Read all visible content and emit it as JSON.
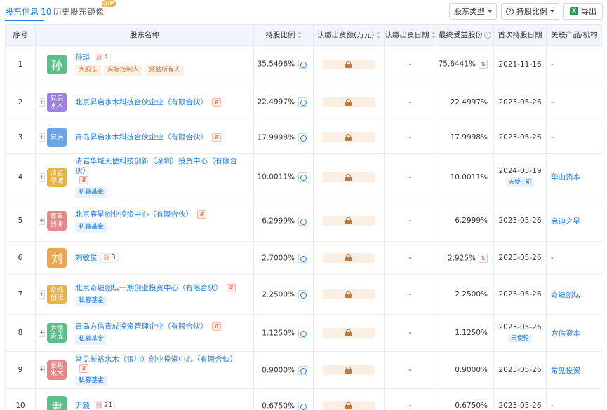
{
  "tabs": {
    "active_label": "股东信息",
    "active_count": "10",
    "history_label": "历史股东镜像",
    "vip_badge": "VIP"
  },
  "toolbar": {
    "type_label": "股东类型",
    "ratio_label": "持股比例",
    "export_label": "导出"
  },
  "columns": {
    "index": "序号",
    "name": "股东名称",
    "ratio": "持股比例",
    "subscribed": "认缴出资额(万元)",
    "sub_date": "认缴出资日期",
    "benefit": "最终受益股份",
    "first_date": "首次持股日期",
    "related": "关联产品/机构"
  },
  "colors": {
    "accent": "#1e7be6",
    "avatar_green": "#5cbf8a",
    "avatar_purple": "#9b7fe0",
    "avatar_blue": "#6aa6e6",
    "avatar_gold": "#e6b34a",
    "avatar_red": "#e38a86",
    "avatar_orange": "#e9a656"
  },
  "rows": [
    {
      "idx": "1",
      "avatar": "孙",
      "avatar_color": "#5cbf8a",
      "avatar_size": "big",
      "name": "孙琪",
      "person_count": "4",
      "tags": [
        "大股东",
        "实际控制人",
        "受益所有人"
      ],
      "fund_tag": "",
      "ratio": "35.5496%",
      "sub_date": "-",
      "benefit": "75.6441%",
      "benefit_icon": true,
      "first_date": "2021-11-16",
      "round": "",
      "related": "-"
    },
    {
      "idx": "2",
      "avatar": "昇启水木",
      "avatar_color": "#9b7fe0",
      "avatar_size": "small",
      "name": "北京昇启水木科技合伙企业（有限合伙）",
      "person_count": "",
      "tags": [],
      "fund_tag": "",
      "ratio": "22.4997%",
      "sub_date": "-",
      "benefit": "22.4997%",
      "benefit_icon": false,
      "first_date": "2023-05-26",
      "round": "",
      "related": "-"
    },
    {
      "idx": "3",
      "avatar": "昇启",
      "avatar_color": "#6aa6e6",
      "avatar_size": "small",
      "name": "青岛昇启水木科技合伙企业（有限合伙）",
      "person_count": "",
      "tags": [],
      "fund_tag": "",
      "ratio": "17.9998%",
      "sub_date": "-",
      "benefit": "17.9998%",
      "benefit_icon": false,
      "first_date": "2023-05-26",
      "round": "",
      "related": "-"
    },
    {
      "idx": "4",
      "avatar": "清岩华域",
      "avatar_color": "#e6b34a",
      "avatar_size": "small",
      "name": "清岩华域天使科技创新（深圳）投资中心（有限合伙）",
      "person_count": "",
      "tags": [],
      "fund_tag": "私募基金",
      "ratio": "10.0011%",
      "sub_date": "-",
      "benefit": "10.0011%",
      "benefit_icon": false,
      "first_date": "2024-03-19",
      "round": "天使+轮",
      "related": "华山资本"
    },
    {
      "idx": "5",
      "avatar": "宸星创业",
      "avatar_color": "#e38a86",
      "avatar_size": "small",
      "name": "北京宸星创业投资中心（有限合伙）",
      "person_count": "",
      "tags": [],
      "fund_tag": "私募基金",
      "ratio": "6.2999%",
      "sub_date": "-",
      "benefit": "6.2999%",
      "benefit_icon": false,
      "first_date": "2023-05-26",
      "round": "",
      "related": "启迪之星"
    },
    {
      "idx": "6",
      "avatar": "刘",
      "avatar_color": "#e9a656",
      "avatar_size": "big",
      "name": "刘敏俊",
      "person_count": "3",
      "tags": [],
      "fund_tag": "",
      "ratio": "2.7000%",
      "sub_date": "-",
      "benefit": "2.925%",
      "benefit_icon": true,
      "first_date": "2023-05-26",
      "round": "",
      "related": "-"
    },
    {
      "idx": "7",
      "avatar": "奇绩创坛",
      "avatar_color": "#e6b34a",
      "avatar_size": "small",
      "name": "北京奇绩创坛一期创业投资中心（有限合伙）",
      "person_count": "",
      "tags": [],
      "fund_tag": "私募基金",
      "ratio": "2.2500%",
      "sub_date": "-",
      "benefit": "2.2500%",
      "benefit_icon": false,
      "first_date": "2023-05-26",
      "round": "",
      "related": "奇绩创坛"
    },
    {
      "idx": "8",
      "avatar": "方信青成",
      "avatar_color": "#5cbf8a",
      "avatar_size": "small",
      "name": "青岛方信青成投资管理企业（有限合伙）",
      "person_count": "",
      "tags": [],
      "fund_tag": "私募基金",
      "ratio": "1.1250%",
      "sub_date": "-",
      "benefit": "1.1250%",
      "benefit_icon": false,
      "first_date": "2023-05-26",
      "round": "天使轮",
      "related": "方信资本"
    },
    {
      "idx": "9",
      "avatar": "长裕水木",
      "avatar_color": "#e38a86",
      "avatar_size": "small",
      "name": "常见长裕水木（银川）创业投资中心（有限合伙）",
      "person_count": "",
      "tags": [],
      "fund_tag": "私募基金",
      "ratio": "0.9000%",
      "sub_date": "-",
      "benefit": "0.9000%",
      "benefit_icon": false,
      "first_date": "2023-05-26",
      "round": "",
      "related": "常见投资"
    },
    {
      "idx": "10",
      "avatar": "尹",
      "avatar_color": "#5cbf8a",
      "avatar_size": "big",
      "name": "尹颖",
      "person_count": "21",
      "tags": [],
      "fund_tag": "",
      "ratio": "0.6750%",
      "sub_date": "-",
      "benefit": "0.6750%",
      "benefit_icon": false,
      "first_date": "2023-05-26",
      "round": "",
      "related": "-"
    }
  ]
}
